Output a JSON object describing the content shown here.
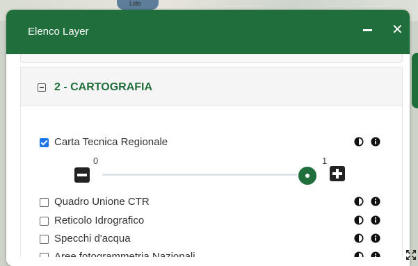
{
  "map": {
    "label": "Lido"
  },
  "panel": {
    "title": "Elenco Layer",
    "minimize_icon": "minus-icon",
    "close_label": "✕"
  },
  "section": {
    "toggle_icon": "collapse-square-icon",
    "title": "2 - CARTOGRAFIA"
  },
  "layers": [
    {
      "label": "Carta Tecnica Regionale",
      "checked": true
    },
    {
      "label": "Quadro Unione CTR",
      "checked": false
    },
    {
      "label": "Reticolo Idrografico",
      "checked": false
    },
    {
      "label": "Specchi d'acqua",
      "checked": false
    },
    {
      "label": "Aree fotogrammetria Nazionali",
      "checked": false
    }
  ],
  "opacity": {
    "min_label": "0",
    "max_label": "1",
    "value": 1
  },
  "icons": {
    "contrast": "contrast-icon",
    "info": "info-icon",
    "resize": "expand-icon"
  },
  "colors": {
    "header": "#1f6e3b",
    "accent": "#1f6e3b",
    "checkbox": "#1a73e8"
  }
}
